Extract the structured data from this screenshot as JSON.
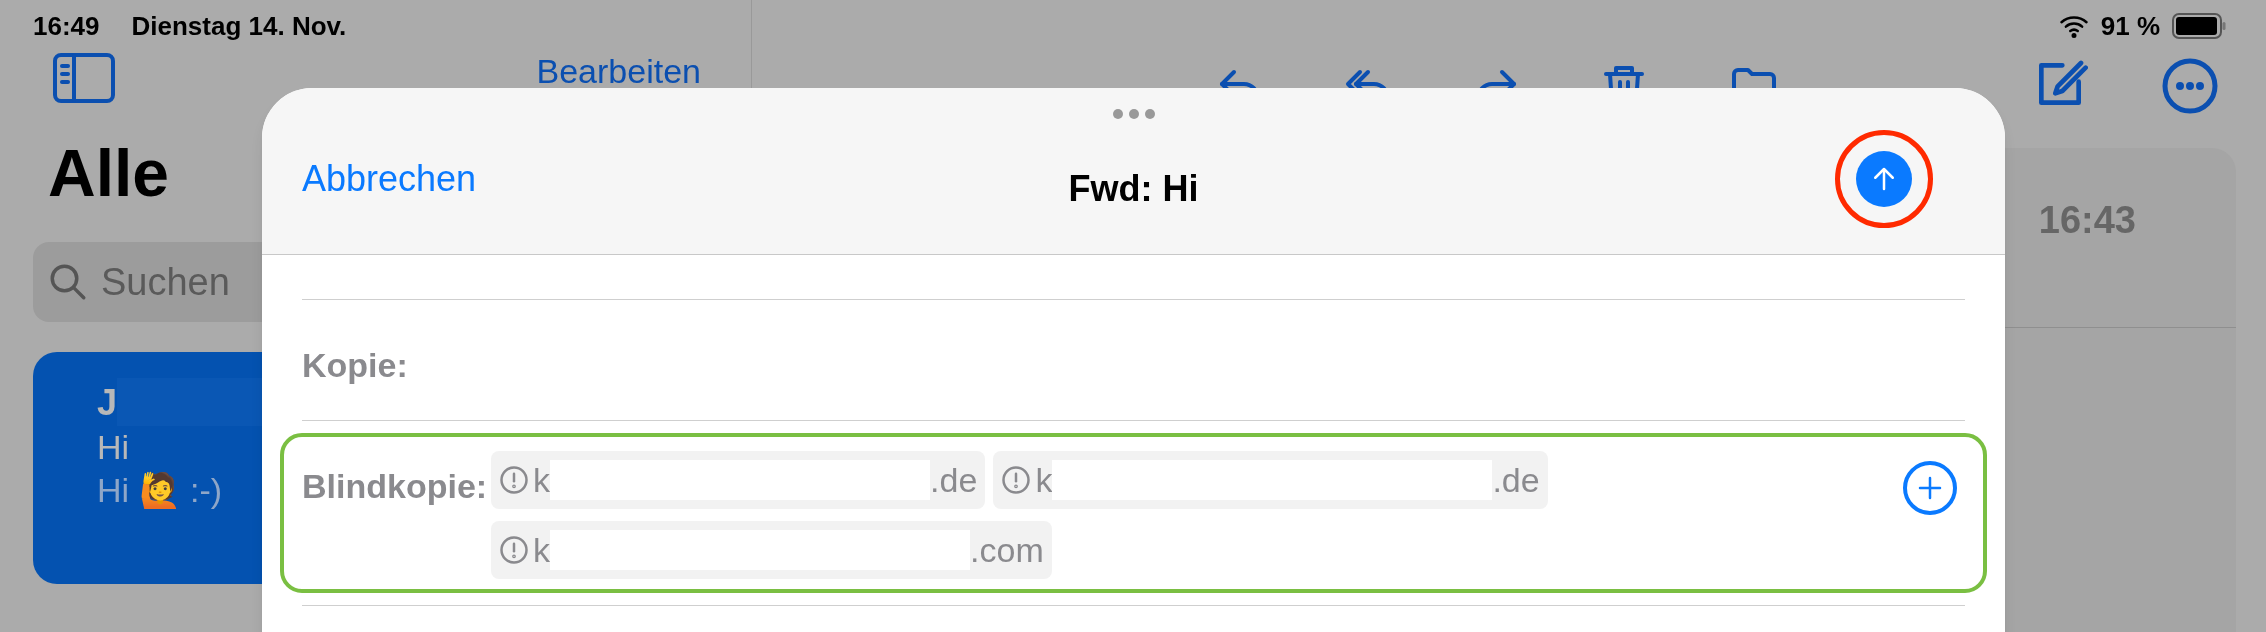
{
  "status_bar": {
    "time": "16:49",
    "date": "Dienstag 14. Nov.",
    "battery": "91 %"
  },
  "sidebar": {
    "edit_label": "Bearbeiten",
    "title": "Alle",
    "search": {
      "placeholder": "Suchen"
    },
    "messages": [
      {
        "sender": "J",
        "subject": "Hi",
        "preview": "Hi 🙋 :-)",
        "selected": true
      }
    ]
  },
  "detail": {
    "time": "16:43"
  },
  "compose": {
    "cancel": "Abbrechen",
    "title": "Fwd: Hi",
    "send_highlighted": true,
    "fields": [
      {
        "label": "Kopie:",
        "highlighted": false
      },
      {
        "label": "Blindkopie:",
        "highlighted": true,
        "recipients": [
          {
            "prefix": "k",
            "suffix": ".de"
          },
          {
            "prefix": "k",
            "suffix": ".de"
          },
          {
            "prefix": "k",
            "suffix": ".com"
          }
        ]
      }
    ]
  }
}
